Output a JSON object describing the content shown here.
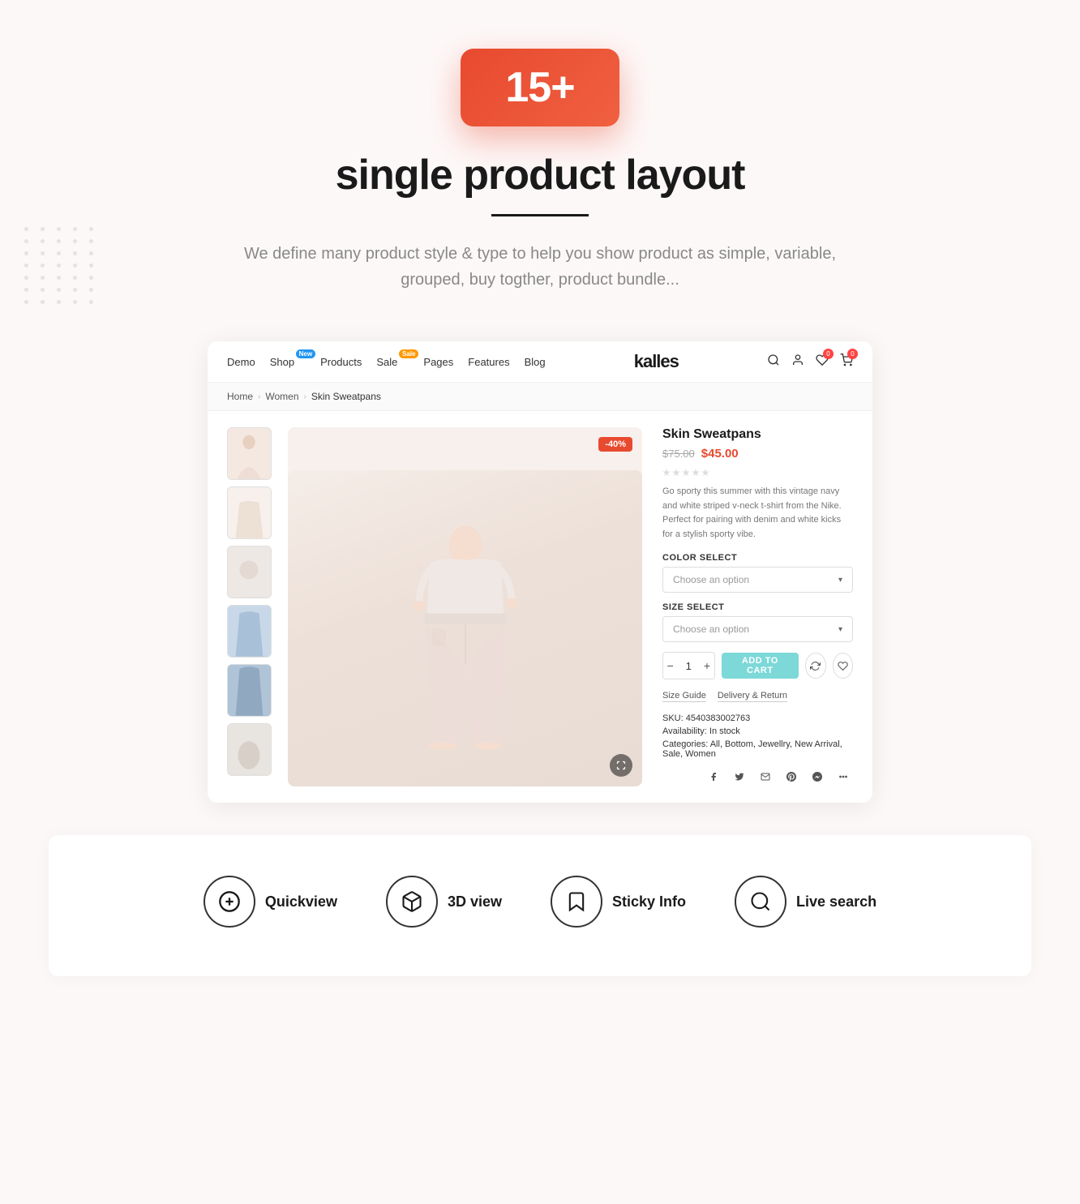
{
  "hero": {
    "badge": "15+",
    "title": "single product layout",
    "description": "We define many product style & type to help you show product as simple, variable, grouped, buy togther, product bundle..."
  },
  "nav": {
    "links": [
      {
        "label": "Demo",
        "badge": null
      },
      {
        "label": "Shop",
        "badge": "New"
      },
      {
        "label": "Products",
        "badge": null
      },
      {
        "label": "Sale",
        "badge": "Sale"
      },
      {
        "label": "Pages",
        "badge": null
      },
      {
        "label": "Features",
        "badge": null
      },
      {
        "label": "Blog",
        "badge": null
      }
    ],
    "logo": "kalles",
    "wishlist_count": "0",
    "cart_count": "0"
  },
  "breadcrumb": {
    "home": "Home",
    "women": "Women",
    "current": "Skin Sweatpans"
  },
  "product": {
    "name": "Skin Sweatpans",
    "price_original": "$75.00",
    "price_sale": "$45.00",
    "discount": "-40%",
    "description": "Go sporty this summer with this vintage navy and white striped v-neck t-shirt from the Nike. Perfect for pairing with denim and white kicks for a stylish sporty vibe.",
    "color_select_label": "COLOR SELECT",
    "color_placeholder": "Choose an option",
    "size_select_label": "SIZE SELECT",
    "size_placeholder": "Choose an option",
    "quantity": "1",
    "add_to_cart": "ADD TO CART",
    "size_guide": "Size Guide",
    "delivery_return": "Delivery & Return",
    "sku_label": "SKU:",
    "sku_value": "4540383002763",
    "availability_label": "Availability:",
    "availability_value": "In stock",
    "categories_label": "Categories:",
    "categories_value": "All, Bottom, Jewellry, New Arrival, Sale, Women"
  },
  "features": [
    {
      "icon": "plus-circle",
      "label": "Quickview",
      "unicode": "⊕"
    },
    {
      "icon": "box-3d",
      "label": "3D view",
      "unicode": "⬡"
    },
    {
      "icon": "bookmark",
      "label": "Sticky Info",
      "unicode": "🔖"
    },
    {
      "icon": "search",
      "label": "Live search",
      "unicode": "🔍"
    }
  ]
}
